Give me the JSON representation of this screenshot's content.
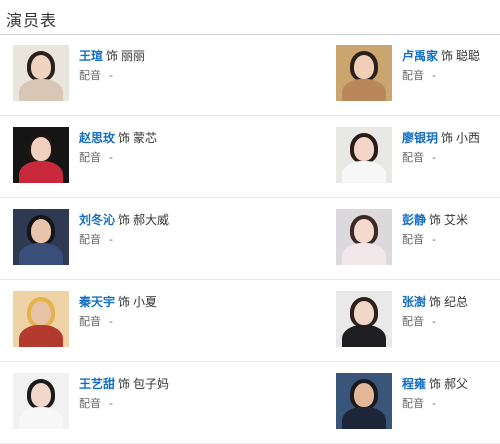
{
  "header": {
    "title": "演员表"
  },
  "labels": {
    "as": "饰",
    "dub": "配音",
    "dub_value": "-"
  },
  "rows": [
    {
      "left": {
        "actor": "王瑄",
        "role": "丽丽",
        "photo": {
          "bg": "#e9e4dc",
          "hair": "#2b211c",
          "face": "#f1d3c2",
          "body": "#d9c7b5"
        }
      },
      "right": {
        "actor": "卢禹家",
        "role": "聪聪",
        "photo": {
          "bg": "#caa56e",
          "hair": "#2b211c",
          "face": "#f0cfb6",
          "body": "#b9875a"
        }
      }
    },
    {
      "left": {
        "actor": "赵思玫",
        "role": "蒙芯",
        "photo": {
          "bg": "#151515",
          "hair": "#1d1414",
          "face": "#f1d0c0",
          "body": "#c8283a"
        }
      },
      "right": {
        "actor": "廖银玥",
        "role": "小西",
        "photo": {
          "bg": "#e8e8e4",
          "hair": "#2a1d18",
          "face": "#f2d5c5",
          "body": "#f7f7f7"
        }
      }
    },
    {
      "left": {
        "actor": "刘冬沁",
        "role": "郝大威",
        "photo": {
          "bg": "#2d3a52",
          "hair": "#151515",
          "face": "#e8c4ab",
          "body": "#3a4e7a"
        }
      },
      "right": {
        "actor": "彭静",
        "role": "艾米",
        "photo": {
          "bg": "#dcd9dd",
          "hair": "#3a2a26",
          "face": "#f5d9cc",
          "body": "#f2e7e9"
        }
      }
    },
    {
      "left": {
        "actor": "秦天宇",
        "role": "小夏",
        "photo": {
          "bg": "#efd2a6",
          "hair": "#e4b44a",
          "face": "#e7c2a6",
          "body": "#b33a2e"
        }
      },
      "right": {
        "actor": "张澍",
        "role": "纪总",
        "photo": {
          "bg": "#e9e9e9",
          "hair": "#2b201c",
          "face": "#f2d6c8",
          "body": "#1f1f22"
        }
      }
    },
    {
      "left": {
        "actor": "王艺甜",
        "role": "包子妈",
        "photo": {
          "bg": "#f1f1f1",
          "hair": "#1b1b1b",
          "face": "#f2d8cc",
          "body": "#f7f7f7"
        }
      },
      "right": {
        "actor": "程雍",
        "role": "郝父",
        "photo": {
          "bg": "#39557a",
          "hair": "#1a1a1a",
          "face": "#e3b89a",
          "body": "#1d2638"
        }
      }
    }
  ]
}
